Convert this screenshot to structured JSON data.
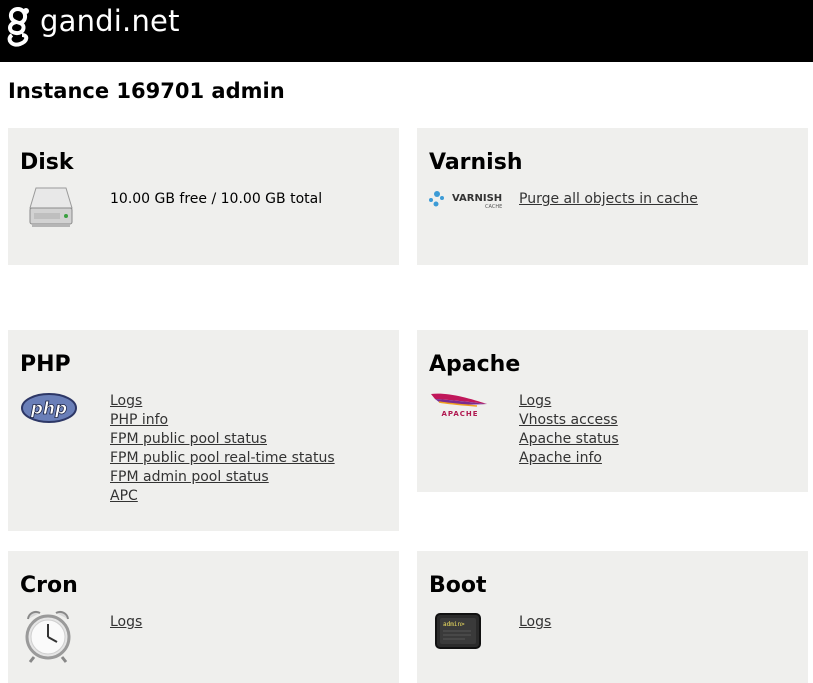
{
  "header": {
    "brand": "gandi.net"
  },
  "page": {
    "title": "Instance 169701 admin"
  },
  "panels": {
    "disk": {
      "title": "Disk",
      "info": "10.00 GB free / 10.00 GB total",
      "icon": "hard-drive-icon"
    },
    "varnish": {
      "title": "Varnish",
      "logo_text": "VARNISH",
      "logo_sub": "CACHE",
      "links": [
        "Purge all objects in cache"
      ],
      "icon": "varnish-logo"
    },
    "php": {
      "title": "PHP",
      "logo_text": "php",
      "icon": "php-logo",
      "links": [
        "Logs",
        "PHP info",
        "FPM public pool status",
        "FPM public pool real-time status",
        "FPM admin pool status",
        "APC"
      ]
    },
    "apache": {
      "title": "Apache",
      "logo_text": "APACHE",
      "icon": "apache-logo",
      "links": [
        "Logs",
        "Vhosts access",
        "Apache status",
        "Apache info"
      ]
    },
    "cron": {
      "title": "Cron",
      "icon": "alarm-clock-icon",
      "links": [
        "Logs"
      ]
    },
    "boot": {
      "title": "Boot",
      "icon": "terminal-icon",
      "screen_text": "admin>",
      "links": [
        "Logs"
      ]
    }
  },
  "colors": {
    "topbar": "#000000",
    "panel": "#efefed",
    "link": "#333333"
  }
}
